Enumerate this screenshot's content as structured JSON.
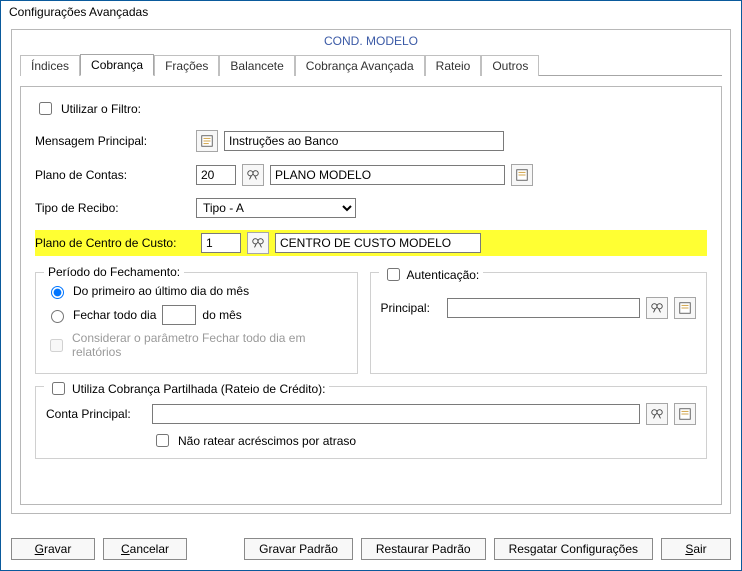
{
  "window_title": "Configurações Avançadas",
  "subtitle": "COND. MODELO",
  "tabs": {
    "t0": "Índices",
    "t1": "Cobrança",
    "t2": "Frações",
    "t3": "Balancete",
    "t4": "Cobrança Avançada",
    "t5": "Rateio",
    "t6": "Outros"
  },
  "filter": {
    "label": "Utilizar o Filtro:"
  },
  "msg": {
    "label": "Mensagem Principal:",
    "value": "Instruções ao Banco"
  },
  "plano": {
    "label": "Plano de Contas:",
    "code": "20",
    "desc": "PLANO MODELO"
  },
  "recibo": {
    "label": "Tipo de Recibo:",
    "value": "Tipo - A"
  },
  "cc": {
    "label": "Plano de Centro de Custo:",
    "code": "1",
    "desc": "CENTRO DE CUSTO MODELO"
  },
  "periodo": {
    "legend": "Período do Fechamento:",
    "opt1": "Do primeiro ao último dia do mês",
    "opt2a": "Fechar todo dia",
    "opt2_val": "",
    "opt2b": "do mês",
    "opt3": "Considerar o parâmetro Fechar todo dia em relatórios"
  },
  "auth": {
    "legend": "Autenticação:",
    "principal_label": "Principal:",
    "principal_value": ""
  },
  "partilha": {
    "legend": "Utiliza Cobrança Partilhada (Rateio de Crédito):",
    "conta_label": "Conta Principal:",
    "conta_value": "",
    "nao_ratear": "Não ratear acréscimos por atraso"
  },
  "footer": {
    "gravar": "Gravar",
    "cancelar": "Cancelar",
    "gravar_padrao": "Gravar Padrão",
    "restaurar": "Restaurar Padrão",
    "resgatar": "Resgatar Configurações",
    "sair": "Sair"
  }
}
